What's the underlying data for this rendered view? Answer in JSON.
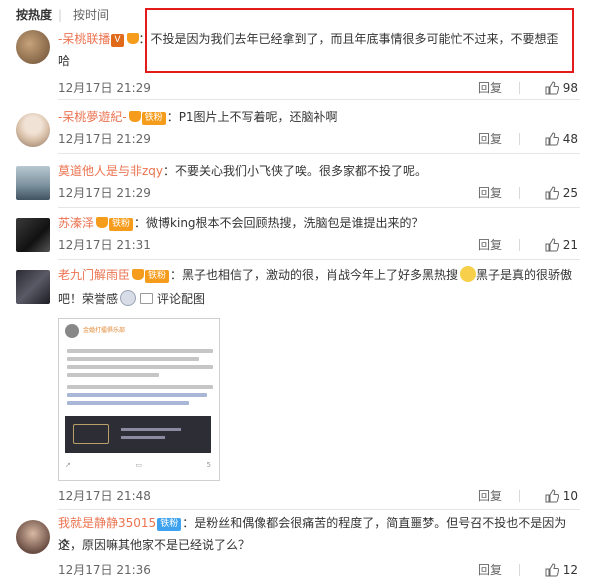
{
  "sort": {
    "hot": "按热度",
    "separator": "|",
    "time": "按时间"
  },
  "comments": [
    {
      "user": "-呆桃联播",
      "badge": "V",
      "badge_color": "#f7b500",
      "text": "：不投是因为我们去年已经拿到了，而且年底事情很多可能忙不过来，不要想歪",
      "text2": "哈",
      "time": "12月17日 21:29",
      "reply": "回复",
      "likes": "98"
    },
    {
      "user": "-呆桃夢遊紀-",
      "badge": "铁粉",
      "badge_color": "#f59c1c",
      "text": "：P1图片上不写着呢，还脑补啊",
      "time": "12月17日 21:29",
      "reply": "回复",
      "likes": "48"
    },
    {
      "user": "莫道他人是与非zqy",
      "text": "：不要关心我们小飞侠了唉。很多家都不投了呢。",
      "time": "12月17日 21:29",
      "reply": "回复",
      "likes": "25"
    },
    {
      "user": "苏溱泽",
      "badge": "铁粉",
      "badge_color": "#f59c1c",
      "text": "：微博king根本不会回顾热搜，洗脑包是谁提出来的？",
      "time": "12月17日 21:31",
      "reply": "回复",
      "likes": "21"
    },
    {
      "user": "老九门解雨臣",
      "badge": "铁粉",
      "badge_color": "#f59c1c",
      "text": "：黑子也相信了，激动的很，肖战今年上了好多黑热搜",
      "text_b": "黑子是真的很骄傲",
      "text2": "吧！荣誉感",
      "comment_pic": "评论配图",
      "time": "12月17日 21:48",
      "reply": "回复",
      "likes": "10"
    },
    {
      "user": "我就是静静35015",
      "badge": "铁粉",
      "badge_color": "#3ea2ee",
      "text": "：是粉丝和偶像都会很痛苦的程度了，简直噩梦。但号召不投也不是因为这",
      "text2": "个，原因嘛其他家不是已经说了么？",
      "time": "12月17日 21:36",
      "reply": "回复",
      "likes": "12"
    }
  ],
  "pic_card": {
    "title": "金婚打擂俱乐部",
    "like_count": "5"
  },
  "colors": {
    "accent": "#eb7350",
    "highlight_box": "#e41b1b"
  }
}
